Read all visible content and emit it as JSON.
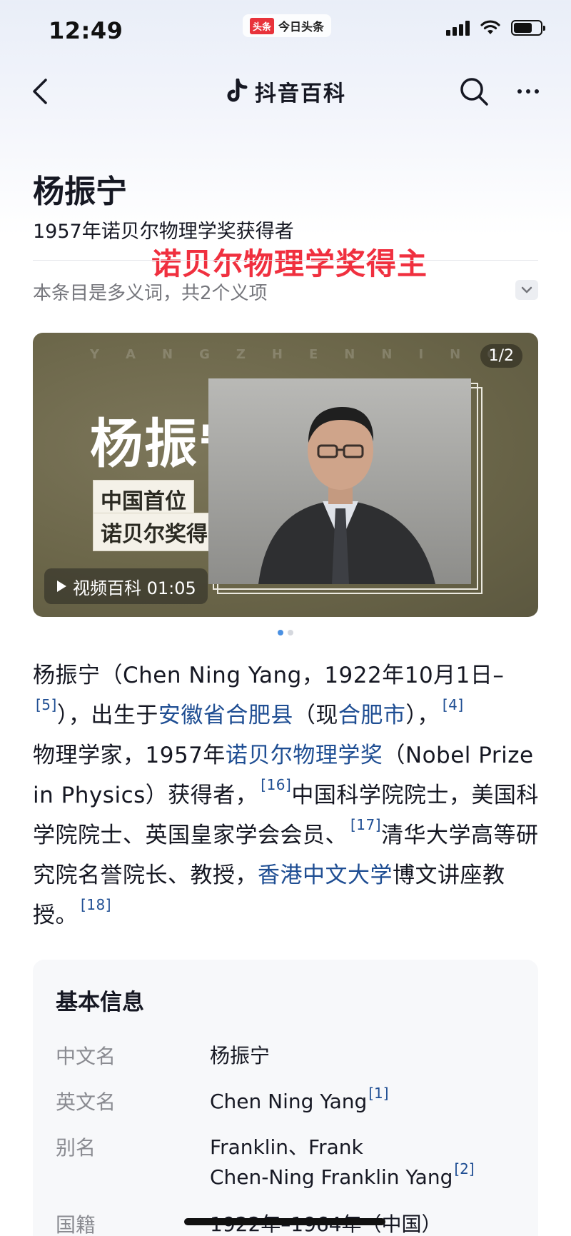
{
  "status_bar": {
    "time": "12:49",
    "source_logo": "头条",
    "source_name": "今日头条"
  },
  "nav": {
    "title": "抖音百科"
  },
  "header": {
    "title": "杨振宁",
    "subtitle": "1957年诺贝尔物理学奖获得者",
    "overlay_caption": "诺贝尔物理学奖得主",
    "ambiguity_note": "本条目是多义词，共2个义项"
  },
  "video_card": {
    "watermark": [
      "Y",
      "A",
      "N",
      "G",
      "Z",
      "H",
      "E",
      "N",
      "N",
      "I",
      "N",
      "G"
    ],
    "page_counter": "1/2",
    "heading": "杨振宁",
    "tag1": "中国首位",
    "tag2": "诺贝尔奖得主",
    "play_label": "视频百科 01:05"
  },
  "intro": {
    "p1": "杨振宁（Chen Ning Yang，1922年10月1日–",
    "ref5": "[5]",
    "p2": "），出生于",
    "link_birthplace": "安徽省合肥县",
    "p3": "（现",
    "link_city": "合肥市",
    "p4": "），",
    "ref4": "[4]",
    "p5": "物理学家，1957年",
    "link_prize": "诺贝尔物理学奖",
    "p6": "（Nobel Prize in Physics）获得者，",
    "ref16": "[16]",
    "p7": "中国科学院院士，美国科学院院士、英国皇家学会会员、",
    "ref17": "[17]",
    "p8": "清华大学高等研究院名誉院长、教授，",
    "link_cuhk": "香港中文大学",
    "p9": "博文讲座教授。",
    "ref18": "[18]"
  },
  "info_box": {
    "title": "基本信息",
    "rows": [
      {
        "label": "中文名",
        "value": "杨振宁",
        "ref": ""
      },
      {
        "label": "英文名",
        "value": "Chen Ning Yang",
        "ref": "[1]"
      },
      {
        "label": "别名",
        "value": "Franklin、Frank",
        "value2": "Chen-Ning Franklin Yang",
        "ref": "[2]"
      },
      {
        "label": "国籍",
        "value": "1922年–1964年（中国）",
        "ref": ""
      }
    ]
  },
  "colors": {
    "link": "#1f4e93",
    "caption_red": "#f0303f",
    "video_bg": "#6b6649"
  }
}
